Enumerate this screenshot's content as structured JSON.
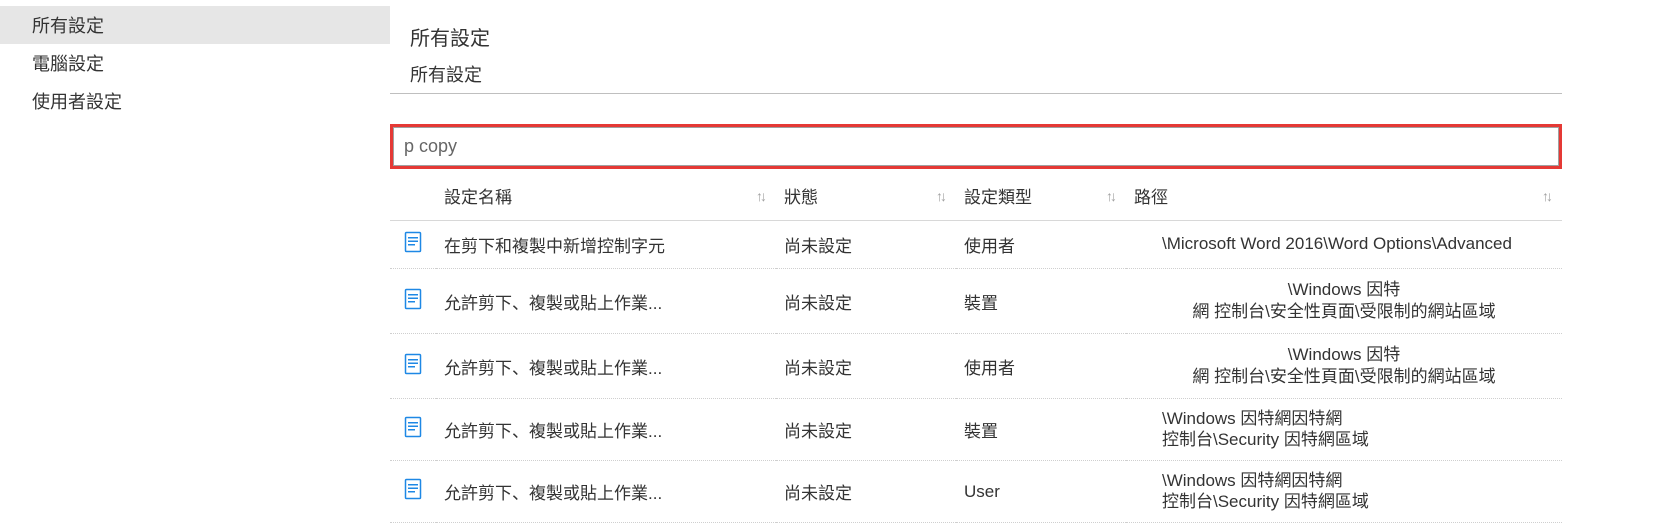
{
  "sidebar": {
    "items": [
      {
        "label": "所有設定",
        "selected": true
      },
      {
        "label": "電腦設定",
        "selected": false
      },
      {
        "label": "使用者設定",
        "selected": false
      }
    ]
  },
  "main": {
    "title": "所有設定",
    "subtitle": "所有設定"
  },
  "search": {
    "value": "p copy"
  },
  "table": {
    "headers": {
      "name": "設定名稱",
      "state": "狀態",
      "type": "設定類型",
      "path": "路徑"
    },
    "rows": [
      {
        "name": "在剪下和複製中新增控制字元",
        "state": "尚未設定",
        "type": "使用者",
        "path_layout": "single",
        "path1": "\\Microsoft Word 2016\\Word Options\\Advanced"
      },
      {
        "name": "允許剪下、複製或貼上作業...",
        "state": "尚未設定",
        "type": "裝置",
        "path_layout": "center2",
        "path1": "\\Windows 因特",
        "path2": "網 控制台\\安全性頁面\\受限制的網站區域"
      },
      {
        "name": "允許剪下、複製或貼上作業...",
        "state": "尚未設定",
        "type": "使用者",
        "path_layout": "center2",
        "path1": "\\Windows 因特",
        "path2": "網 控制台\\安全性頁面\\受限制的網站區域"
      },
      {
        "name": "允許剪下、複製或貼上作業...",
        "state": "尚未設定",
        "type": "裝置",
        "path_layout": "left2",
        "path1": "\\Windows 因特網因特網",
        "path2": "控制台\\Security 因特網區域"
      },
      {
        "name": "允許剪下、複製或貼上作業...",
        "state": "尚未設定",
        "type": "User",
        "path_layout": "left2",
        "path1": "\\Windows 因特網因特網",
        "path2": "控制台\\Security 因特網區域"
      }
    ]
  }
}
